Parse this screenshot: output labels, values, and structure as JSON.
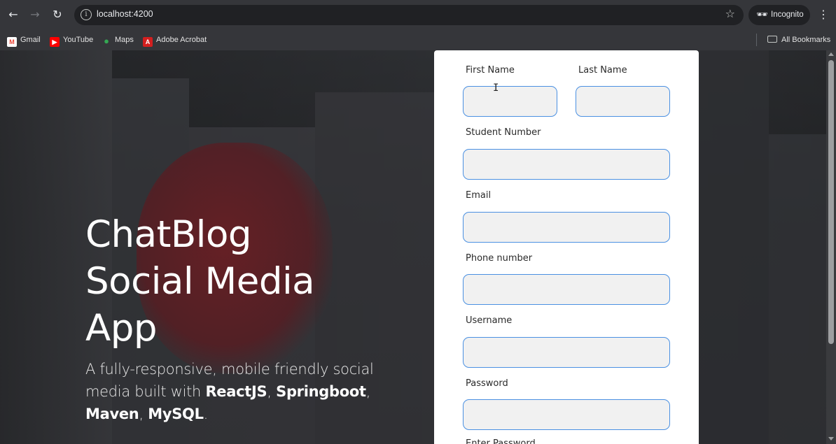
{
  "browser": {
    "url": "localhost:4200",
    "incognito_label": "Incognito",
    "bookmarks": [
      {
        "label": "Gmail",
        "icon": "gmail-icon",
        "color": "#ea4335"
      },
      {
        "label": "YouTube",
        "icon": "youtube-icon",
        "color": "#ff0000"
      },
      {
        "label": "Maps",
        "icon": "maps-icon",
        "color": "#34a853"
      },
      {
        "label": "Adobe Acrobat",
        "icon": "adobe-acrobat-icon",
        "color": "#d31f1f"
      }
    ],
    "all_bookmarks_label": "All Bookmarks"
  },
  "hero": {
    "title_line1": "ChatBlog",
    "title_line2": "Social Media",
    "title_line3": "App",
    "subtitle_part1": "A fully-responsive, mobile friendly social media built with ",
    "tech1": "ReactJS",
    "sep1": ", ",
    "tech2": "Springboot",
    "sep2": ", ",
    "tech3": "Maven",
    "sep3": ", ",
    "tech4": "MySQL",
    "end": "."
  },
  "form": {
    "first_name_label": "First Name",
    "last_name_label": "Last Name",
    "student_number_label": "Student Number",
    "email_label": "Email",
    "phone_label": "Phone number",
    "username_label": "Username",
    "password_label": "Password",
    "next_label_partial": "Enter Password"
  }
}
